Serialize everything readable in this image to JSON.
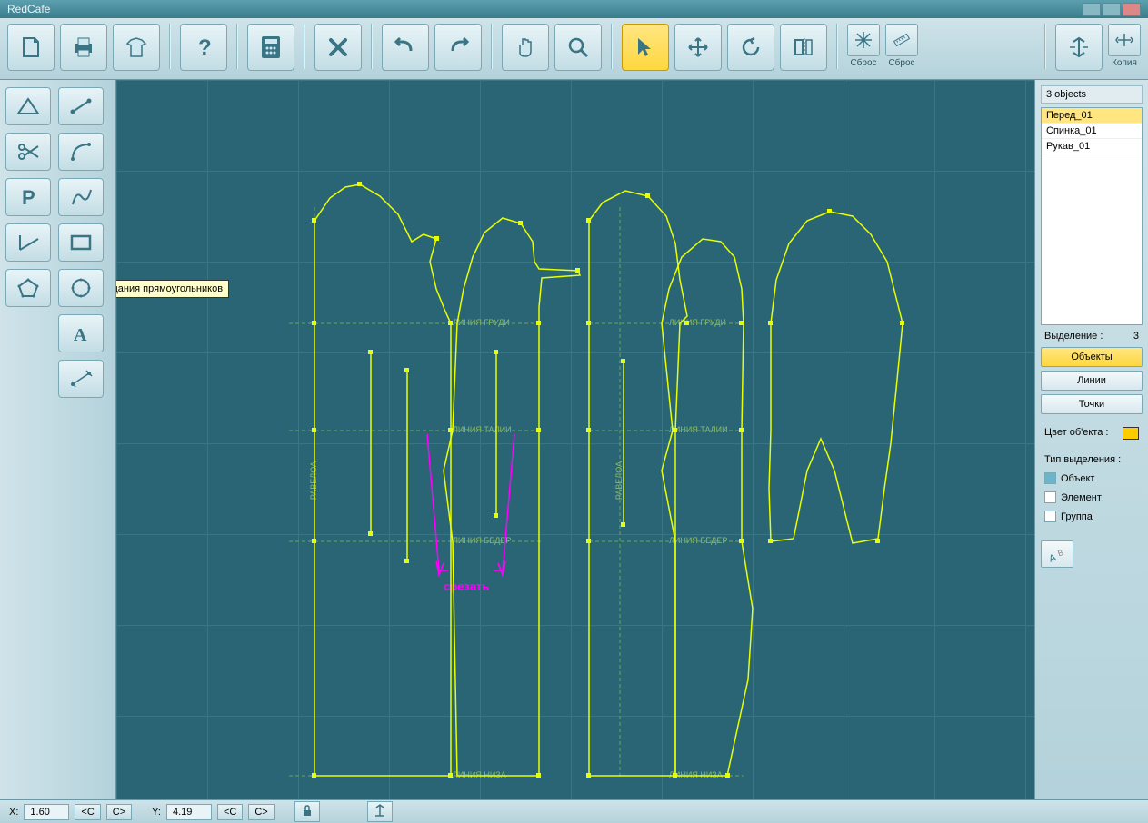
{
  "app": {
    "title": "RedCafe"
  },
  "tooltip": "Режим создания прямоугольников",
  "toolbar": {
    "reset1": "Сброс",
    "reset2": "Сброс",
    "copy": "Копия"
  },
  "panel": {
    "header": "3 objects",
    "objects": [
      "Перед_01",
      "Спинка_01",
      "Рукав_01"
    ],
    "sel_label": "Выделение :",
    "sel_count": "3",
    "btn_objects": "Объекты",
    "btn_lines": "Линии",
    "btn_points": "Точки",
    "color_label": "Цвет об'екта :",
    "color": "#ffcc00",
    "type_label": "Тип выделения :",
    "chk_object": "Объект",
    "chk_element": "Элемент",
    "chk_group": "Группа"
  },
  "canvas": {
    "line_grudi": "ЛИНИЯ ГРУДИ",
    "line_talii": "ЛИНИЯ ТАЛИИ",
    "line_beder": "ЛИНИЯ БЕДЕР",
    "line_niza": "ЛИНИЯ НИЗА",
    "ravels": "РАВЕЛОА",
    "annotation": "срезать"
  },
  "status": {
    "x_label": "X:",
    "x_val": "1.60",
    "y_label": "Y:",
    "y_val": "4.19",
    "lt": "<C",
    "gt": "C>"
  }
}
